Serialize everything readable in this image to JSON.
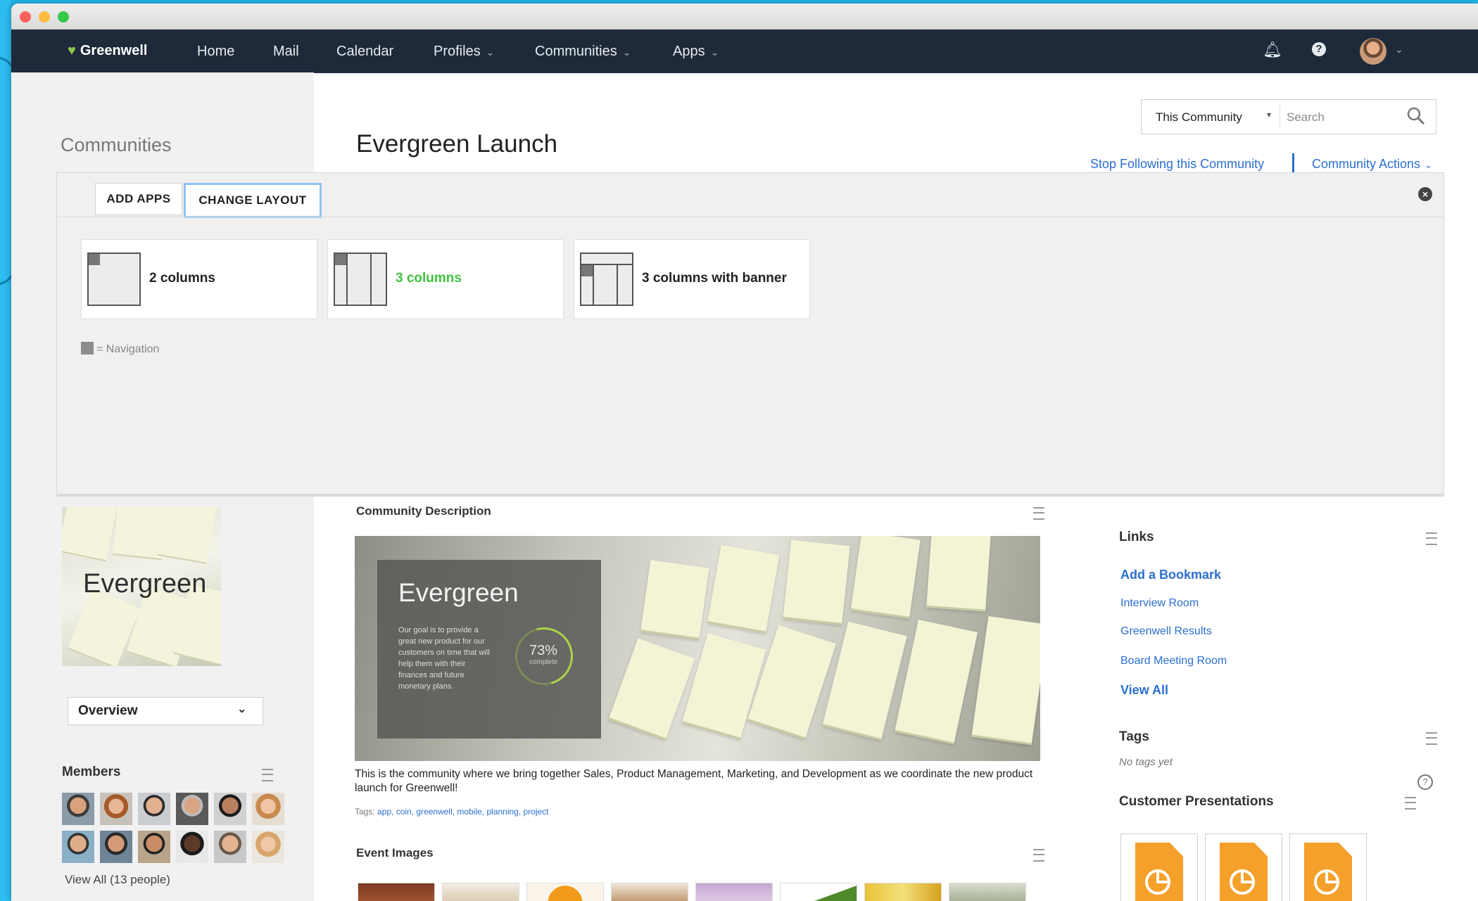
{
  "nav": {
    "brand": "Greenwell",
    "items": [
      {
        "label": "Home",
        "has_menu": false
      },
      {
        "label": "Mail",
        "has_menu": false
      },
      {
        "label": "Calendar",
        "has_menu": false
      },
      {
        "label": "Profiles",
        "has_menu": true
      },
      {
        "label": "Communities",
        "has_menu": true
      },
      {
        "label": "Apps",
        "has_menu": true
      }
    ],
    "icons": [
      "bell-icon",
      "help-icon",
      "avatar",
      "chevron-down-icon"
    ]
  },
  "page": {
    "breadcrumb": "Communities",
    "title": "Evergreen Launch"
  },
  "search": {
    "scope": "This Community",
    "placeholder": "Search"
  },
  "community_links": {
    "stop_following": "Stop Following this Community",
    "actions": "Community Actions"
  },
  "layout_panel": {
    "tabs": [
      {
        "label": "ADD APPS",
        "active": false
      },
      {
        "label": "CHANGE LAYOUT",
        "active": true
      }
    ],
    "options": [
      {
        "label": "2 columns",
        "selected": false
      },
      {
        "label": "3 columns",
        "selected": true
      },
      {
        "label": "3 columns with banner",
        "selected": false
      }
    ],
    "legend": "= Navigation",
    "selected_color": "#3fc23f"
  },
  "left": {
    "logo_text": "Evergreen",
    "view_select": "Overview",
    "members_title": "Members",
    "members_view_all": "View All (13 people)"
  },
  "description": {
    "title": "Community Description",
    "hero_title": "Evergreen",
    "hero_body": "Our goal is to provide a great new product for our customers on time that will help them with their finances and future monetary plans.",
    "hero_percent": "73%",
    "hero_percent_label": "complete",
    "text": "This is the community where we bring together Sales, Product Management, Marketing, and Development as we coordinate the new product launch for Greenwell!",
    "tags_label": "Tags:",
    "tags": "app, coin, greenwell, mobile, planning, project"
  },
  "event_images": {
    "title": "Event Images"
  },
  "links": {
    "title": "Links",
    "items": [
      "Add a Bookmark",
      "Interview Room",
      "Greenwell Results",
      "Board Meeting Room",
      "View All"
    ]
  },
  "tags_widget": {
    "title": "Tags",
    "empty": "No tags yet"
  },
  "presentations": {
    "title": "Customer Presentations",
    "file_color": "#f5a02a"
  },
  "colors": {
    "nav_bg": "#1e2a3a",
    "link": "#2b6fd0",
    "page_bg": "#1fb3e6"
  }
}
